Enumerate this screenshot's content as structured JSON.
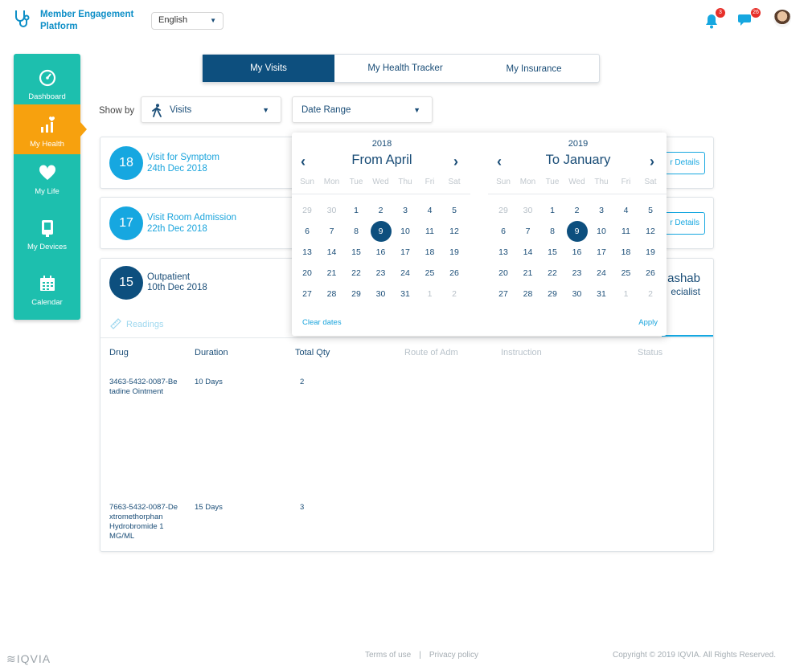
{
  "app": {
    "title_line1": "Member Engagement",
    "title_line2": "Platform",
    "language": "English"
  },
  "header": {
    "notifications_count": "3",
    "messages_count": "26"
  },
  "sidebar": {
    "items": [
      {
        "label": "Dashboard",
        "icon": "gauge-icon"
      },
      {
        "label": "My Health",
        "icon": "chart-heart-icon",
        "active": true
      },
      {
        "label": "My Life",
        "icon": "heart-icon"
      },
      {
        "label": "My Devices",
        "icon": "device-icon"
      },
      {
        "label": "Calendar",
        "icon": "calendar-icon"
      }
    ]
  },
  "tabs": [
    {
      "label": "My Visits",
      "active": true
    },
    {
      "label": "My Health Tracker"
    },
    {
      "label": "My Insurance"
    }
  ],
  "filter": {
    "show_by_label": "Show by",
    "show_by_value": "Visits",
    "date_range_label": "Date Range"
  },
  "visits": [
    {
      "day": "18",
      "title": "Visit for Symptom",
      "date": "24th Dec 2018",
      "button": "r Details"
    },
    {
      "day": "17",
      "title": "Visit Room Admission",
      "date": "22th Dec 2018",
      "button": "r Details"
    },
    {
      "day": "15",
      "title": "Outpatient",
      "date": "10th Dec 2018",
      "doctor": "ashab",
      "specialty": "ecialist",
      "readings": "Readings"
    }
  ],
  "drug_table": {
    "headers": [
      "Drug",
      "Duration",
      "Total Qty",
      "Route of Adm",
      "Instruction",
      "Status"
    ],
    "rows": [
      {
        "drug": "3463-5432-0087-Be tadine Ointment",
        "duration": "10 Days",
        "qty": "2"
      },
      {
        "drug": "7663-5432-0087-De xtromethorphan Hydrobromide 1 MG/ML",
        "duration": "15 Days",
        "qty": "3"
      }
    ]
  },
  "date_picker": {
    "weekdays": [
      "Sun",
      "Mon",
      "Tue",
      "Wed",
      "Thu",
      "Fri",
      "Sat"
    ],
    "from": {
      "year": "2018",
      "month_label": "From April",
      "weeks": [
        [
          "29",
          "30",
          "1",
          "2",
          "3",
          "4",
          "5"
        ],
        [
          "6",
          "7",
          "8",
          "9",
          "10",
          "11",
          "12"
        ],
        [
          "13",
          "14",
          "15",
          "16",
          "17",
          "18",
          "19"
        ],
        [
          "20",
          "21",
          "22",
          "23",
          "24",
          "25",
          "26"
        ],
        [
          "27",
          "28",
          "29",
          "30",
          "31",
          "1",
          "2"
        ]
      ]
    },
    "to": {
      "year": "2019",
      "month_label": "To January",
      "weeks": [
        [
          "29",
          "30",
          "1",
          "2",
          "3",
          "4",
          "5"
        ],
        [
          "6",
          "7",
          "8",
          "9",
          "10",
          "11",
          "12"
        ],
        [
          "13",
          "14",
          "15",
          "16",
          "17",
          "18",
          "19"
        ],
        [
          "20",
          "21",
          "22",
          "23",
          "24",
          "25",
          "26"
        ],
        [
          "27",
          "28",
          "29",
          "30",
          "31",
          "1",
          "2"
        ]
      ]
    },
    "selected_day": "9",
    "clear_label": "Clear dates",
    "apply_label": "Apply"
  },
  "footer": {
    "brand": "IQVIA",
    "terms": "Terms of use",
    "privacy": "Privacy policy",
    "copyright": "Copyright © 2019 IQVIA. All Rights Reserved."
  },
  "colors": {
    "primary": "#0d4f7e",
    "accent": "#16a7e0",
    "sidebar": "#1dbfae",
    "active_nav": "#f7a10e",
    "badge": "#e7302a"
  }
}
